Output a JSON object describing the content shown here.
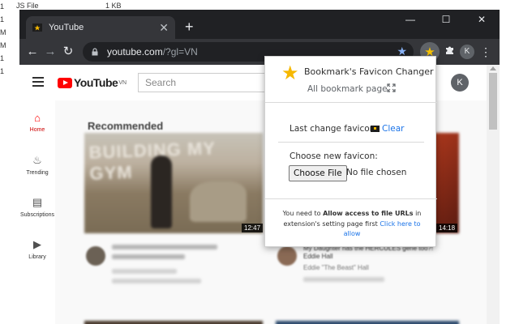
{
  "explorer": {
    "file_type": "JS File",
    "file_size": "1 KB",
    "left_markers": [
      "1",
      "1",
      "M",
      "M",
      "1",
      "1"
    ]
  },
  "browser": {
    "tab_title": "YouTube",
    "url_host": "youtube.com",
    "url_path": "/?gl=VN",
    "profile_initial": "K",
    "icons": {
      "back": "arrow-left-icon",
      "forward": "arrow-right-icon",
      "reload": "reload-icon",
      "lock": "lock-icon",
      "bookmark_star": "star-icon",
      "extension": "star-extension-icon",
      "extensions_menu": "puzzle-icon",
      "menu": "kebab-menu-icon"
    }
  },
  "youtube": {
    "logo_text": "YouTube",
    "region": "VN",
    "search_placeholder": "Search",
    "avatar_initial": "K",
    "guide": [
      {
        "label": "Home",
        "icon": "home-icon",
        "active": true
      },
      {
        "label": "Trending",
        "icon": "flame-icon",
        "active": false
      },
      {
        "label": "Subscriptions",
        "icon": "subscriptions-icon",
        "active": false
      },
      {
        "label": "Library",
        "icon": "library-icon",
        "active": false
      }
    ],
    "section_title": "Recommended",
    "videos": [
      {
        "thumb_text": "BUILDING MY GYM",
        "duration": "12:47"
      },
      {
        "thumb_text": "",
        "duration": "14:18",
        "title": "My Daughter has the HERCULES gene too?! Eddie Hall",
        "channel": "Eddie \"The Beast\" Hall"
      }
    ]
  },
  "popup": {
    "title": "Bookmark's Favicon Changer",
    "all_bookmark_link": "All bookmark page",
    "last_change_label": "Last change favicon",
    "clear_link": "Clear",
    "choose_label": "Choose new favicon:",
    "choose_button": "Choose File",
    "no_file": "No file chosen",
    "notice_pre": "You need to ",
    "notice_bold": "Allow access to file URLs",
    "notice_mid": " in extension's setting page first ",
    "notice_link": "Click here to allow",
    "colors": {
      "star": "#f6b800",
      "link": "#1a73e8"
    }
  }
}
